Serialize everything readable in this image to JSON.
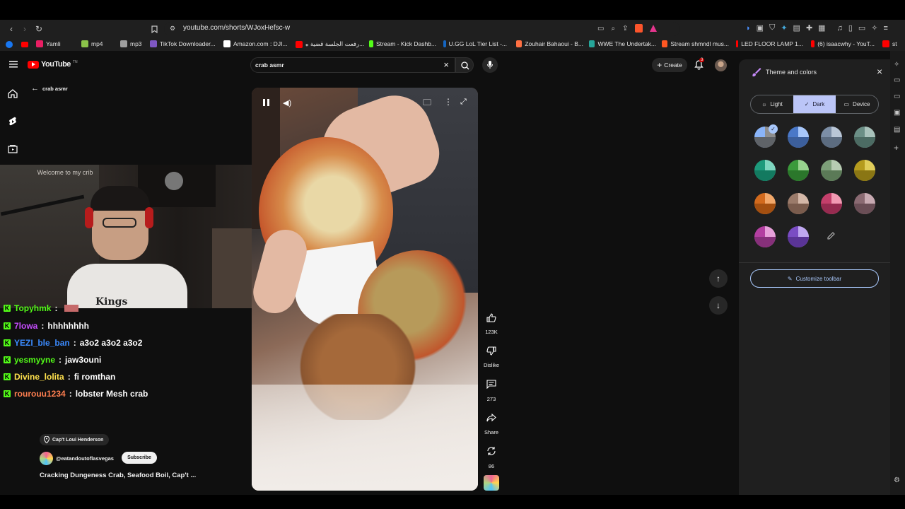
{
  "browser": {
    "url": "youtube.com/shorts/WJoxHefsc-w",
    "bookmarks": [
      {
        "label": "Yamli",
        "color": "#e91e63"
      },
      {
        "label": "mp4",
        "color": "#8bc34a"
      },
      {
        "label": "mp3",
        "color": "#9e9e9e"
      },
      {
        "label": "TikTok Downloader...",
        "color": "#7e57c2"
      },
      {
        "label": "Amazon.com : DJI...",
        "color": "#ffffff"
      },
      {
        "label": "رفعت الجلسة قضية ه...",
        "color": "#ff0000"
      },
      {
        "label": "Stream - Kick Dashb...",
        "color": "#53fc18"
      },
      {
        "label": "U.GG LoL Tier List -...",
        "color": "#1565c0"
      },
      {
        "label": "Zouhair Bahaoui - B...",
        "color": "#ff7043"
      },
      {
        "label": "WWE The Undertak...",
        "color": "#26a69a"
      },
      {
        "label": "Stream shmndl mus...",
        "color": "#ff5722"
      },
      {
        "label": "LED FLOOR LAMP 1...",
        "color": "#ff0000"
      },
      {
        "label": "(6) isaacwhy - YouT...",
        "color": "#ff0000"
      },
      {
        "label": "st",
        "color": "#ff0000"
      }
    ]
  },
  "youtube": {
    "logo": "YouTube",
    "logo_sup": "TN",
    "back_label": "crab asmr",
    "search_value": "crab asmr",
    "create_label": "Create",
    "notif_count": "3"
  },
  "cam": {
    "sign_text": "Welcome to my crib",
    "shirt_text": "Kings"
  },
  "chat": [
    {
      "user": "Topyhmk",
      "msg": "",
      "color": "#53fc18"
    },
    {
      "user": "7lowa",
      "msg": "hhhhhhhh",
      "color": "#c64dff"
    },
    {
      "user": "YEZI_ble_ban",
      "msg": "a3o2 a3o2 a3o2",
      "color": "#3b8bff"
    },
    {
      "user": "yesmyyne",
      "msg": "jaw3ouni",
      "color": "#53fc18"
    },
    {
      "user": "Divine_lolita",
      "msg": "fi romthan",
      "color": "#ffe14d"
    },
    {
      "user": "rourouu1234",
      "msg": "lobster Mesh crab",
      "color": "#ff7f50"
    }
  ],
  "short_info": {
    "location": "Cap't Loui Henderson",
    "channel": "@eatandoutoflasvegas",
    "subscribe": "Subscribe",
    "title": "Cracking Dungeness Crab, Seafood Boil, Cap't ..."
  },
  "actions": {
    "like_count": "123K",
    "dislike_label": "Dislike",
    "comments_count": "273",
    "share_label": "Share",
    "remix_count": "86"
  },
  "panel": {
    "title": "Theme and colors",
    "modes": [
      "Light",
      "Dark",
      "Device"
    ],
    "selected_mode": "Dark",
    "customize_label": "Customize toolbar",
    "swatches": [
      [
        "#8ab4f8",
        "#8e8e8e",
        "#5f6368"
      ],
      [
        "#4a78c8",
        "#a8c7fa",
        "#3c5f9c"
      ],
      [
        "#7c8ea6",
        "#b9c6d6",
        "#5c6c80"
      ],
      [
        "#6b8f86",
        "#a9c2bb",
        "#4c6b63"
      ],
      [
        "#1d9a7c",
        "#7fd6c0",
        "#137a60"
      ],
      [
        "#3b9a3b",
        "#98d38e",
        "#2b772b"
      ],
      [
        "#7d9f79",
        "#b7ccb2",
        "#5b7a57"
      ],
      [
        "#b59b1e",
        "#e0cd5a",
        "#8a7614"
      ],
      [
        "#d26a1d",
        "#f2a86a",
        "#a34f10"
      ],
      [
        "#9b7b6a",
        "#d4b8a8",
        "#7a5c4d"
      ],
      [
        "#c43f6b",
        "#f29ab3",
        "#962b50"
      ],
      [
        "#8a6a72",
        "#c8aab2",
        "#6a4e56"
      ],
      [
        "#b33fa1",
        "#e7a0da",
        "#86307a"
      ],
      [
        "#7a4cc4",
        "#c0a8f0",
        "#5a3496"
      ]
    ]
  }
}
